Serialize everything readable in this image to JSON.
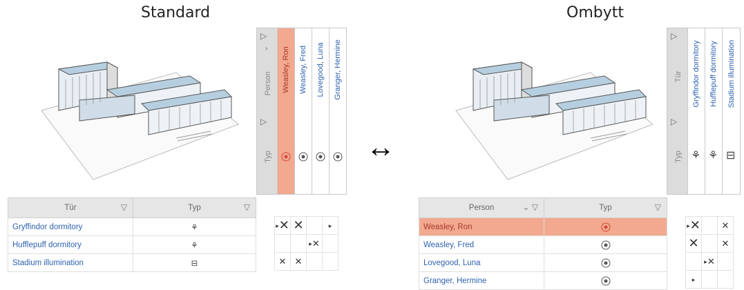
{
  "left": {
    "title": "Standard",
    "header_labels": {
      "top": "Person",
      "bottom": "Typ"
    },
    "persons": [
      "Weasley, Ron",
      "Weasley, Fred",
      "Lovegood, Luna",
      "Granger, Hermine"
    ],
    "table": {
      "col1": "Tür",
      "col2": "Typ",
      "rows": [
        "Gryffindor dormitory",
        "Hufflepuff dormitory",
        "Stadium illumination"
      ]
    }
  },
  "right": {
    "title": "Ombytt",
    "header_labels": {
      "top": "Tür",
      "bottom": "Typ"
    },
    "doors": [
      "Gryffindor dormitory",
      "Hufflepuff dormitory",
      "Stadium illumination"
    ],
    "table": {
      "col1": "Person",
      "col2": "Typ",
      "rows": [
        "Weasley, Ron",
        "Weasley, Fred",
        "Lovegood, Luna",
        "Granger, Hermine"
      ]
    }
  },
  "arrow": "↔",
  "colors": {
    "selected": "#f2a98f",
    "link": "#2e62b0",
    "header": "#dcdcdc"
  }
}
